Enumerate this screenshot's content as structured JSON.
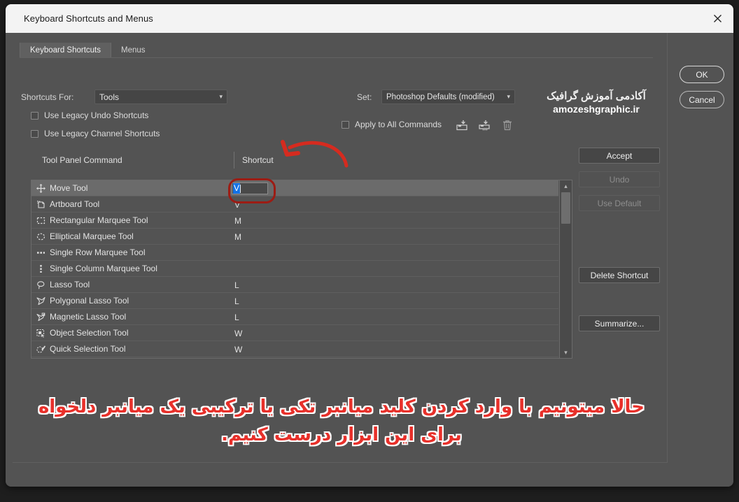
{
  "window": {
    "title": "Keyboard Shortcuts and Menus",
    "close_icon": "close-icon"
  },
  "tabs": [
    {
      "label": "Keyboard Shortcuts",
      "active": true
    },
    {
      "label": "Menus",
      "active": false
    }
  ],
  "controls": {
    "shortcuts_for_label": "Shortcuts For:",
    "shortcuts_for_value": "Tools",
    "set_label": "Set:",
    "set_value": "Photoshop Defaults (modified)",
    "caret_icon": "chevron-down-icon",
    "checkboxes": [
      {
        "label": "Use Legacy Undo Shortcuts",
        "checked": false
      },
      {
        "label": "Use Legacy Channel Shortcuts",
        "checked": false
      },
      {
        "label": "Apply to All Commands",
        "checked": false
      }
    ],
    "icon_buttons": [
      {
        "name": "save-set-icon"
      },
      {
        "name": "save-set-as-icon"
      },
      {
        "name": "delete-set-icon"
      }
    ]
  },
  "watermark": {
    "persian": "آکادمی آموزش گرافیک",
    "site": "amozeshgraphic.ir"
  },
  "list": {
    "columns": [
      "Tool Panel Command",
      "Shortcut"
    ],
    "editing": {
      "row_index": 0,
      "selected_text": "V",
      "highlight_color": "#1473e6"
    },
    "rows": [
      {
        "icon": "move-tool-icon",
        "name": "Move Tool",
        "shortcut": "V",
        "selected": true,
        "editing": true
      },
      {
        "icon": "artboard-tool-icon",
        "name": "Artboard Tool",
        "shortcut": "V",
        "selected": false,
        "editing": false
      },
      {
        "icon": "rectangular-marquee-tool-icon",
        "name": "Rectangular Marquee Tool",
        "shortcut": "M",
        "selected": false,
        "editing": false
      },
      {
        "icon": "elliptical-marquee-tool-icon",
        "name": "Elliptical Marquee Tool",
        "shortcut": "M",
        "selected": false,
        "editing": false
      },
      {
        "icon": "single-row-marquee-tool-icon",
        "name": "Single Row Marquee Tool",
        "shortcut": "",
        "selected": false,
        "editing": false
      },
      {
        "icon": "single-column-marquee-tool-icon",
        "name": "Single Column Marquee Tool",
        "shortcut": "",
        "selected": false,
        "editing": false
      },
      {
        "icon": "lasso-tool-icon",
        "name": "Lasso Tool",
        "shortcut": "L",
        "selected": false,
        "editing": false
      },
      {
        "icon": "polygonal-lasso-tool-icon",
        "name": "Polygonal Lasso Tool",
        "shortcut": "L",
        "selected": false,
        "editing": false
      },
      {
        "icon": "magnetic-lasso-tool-icon",
        "name": "Magnetic Lasso Tool",
        "shortcut": "L",
        "selected": false,
        "editing": false
      },
      {
        "icon": "object-selection-tool-icon",
        "name": "Object Selection Tool",
        "shortcut": "W",
        "selected": false,
        "editing": false
      },
      {
        "icon": "quick-selection-tool-icon",
        "name": "Quick Selection Tool",
        "shortcut": "W",
        "selected": false,
        "editing": false
      }
    ],
    "scrollbar": {
      "up_icon": "chevron-up-icon",
      "down_icon": "chevron-down-icon"
    }
  },
  "side_buttons": [
    {
      "label": "Accept",
      "enabled": true
    },
    {
      "label": "Undo",
      "enabled": false
    },
    {
      "label": "Use Default",
      "enabled": false
    },
    {
      "label": "Delete Shortcut",
      "enabled": true
    },
    {
      "label": "Summarize...",
      "enabled": true
    }
  ],
  "dialog_buttons": [
    {
      "label": "OK",
      "primary": true
    },
    {
      "label": "Cancel",
      "primary": false
    }
  ],
  "annotations": {
    "arrow_color": "#d62b1f",
    "oval_color": "#9c1c14",
    "caption_line1": "حالا میتونیم با وارد کردن کلید میانبر تکی یا ترکیبی یک میانبر دلخواه",
    "caption_line2": "برای این ابزار درست کنیم."
  },
  "colors": {
    "dialog_bg": "#535353",
    "titlebar_bg": "#f3f3f3",
    "accent_selection": "#1473e6",
    "annotation_red": "#e8302a"
  }
}
